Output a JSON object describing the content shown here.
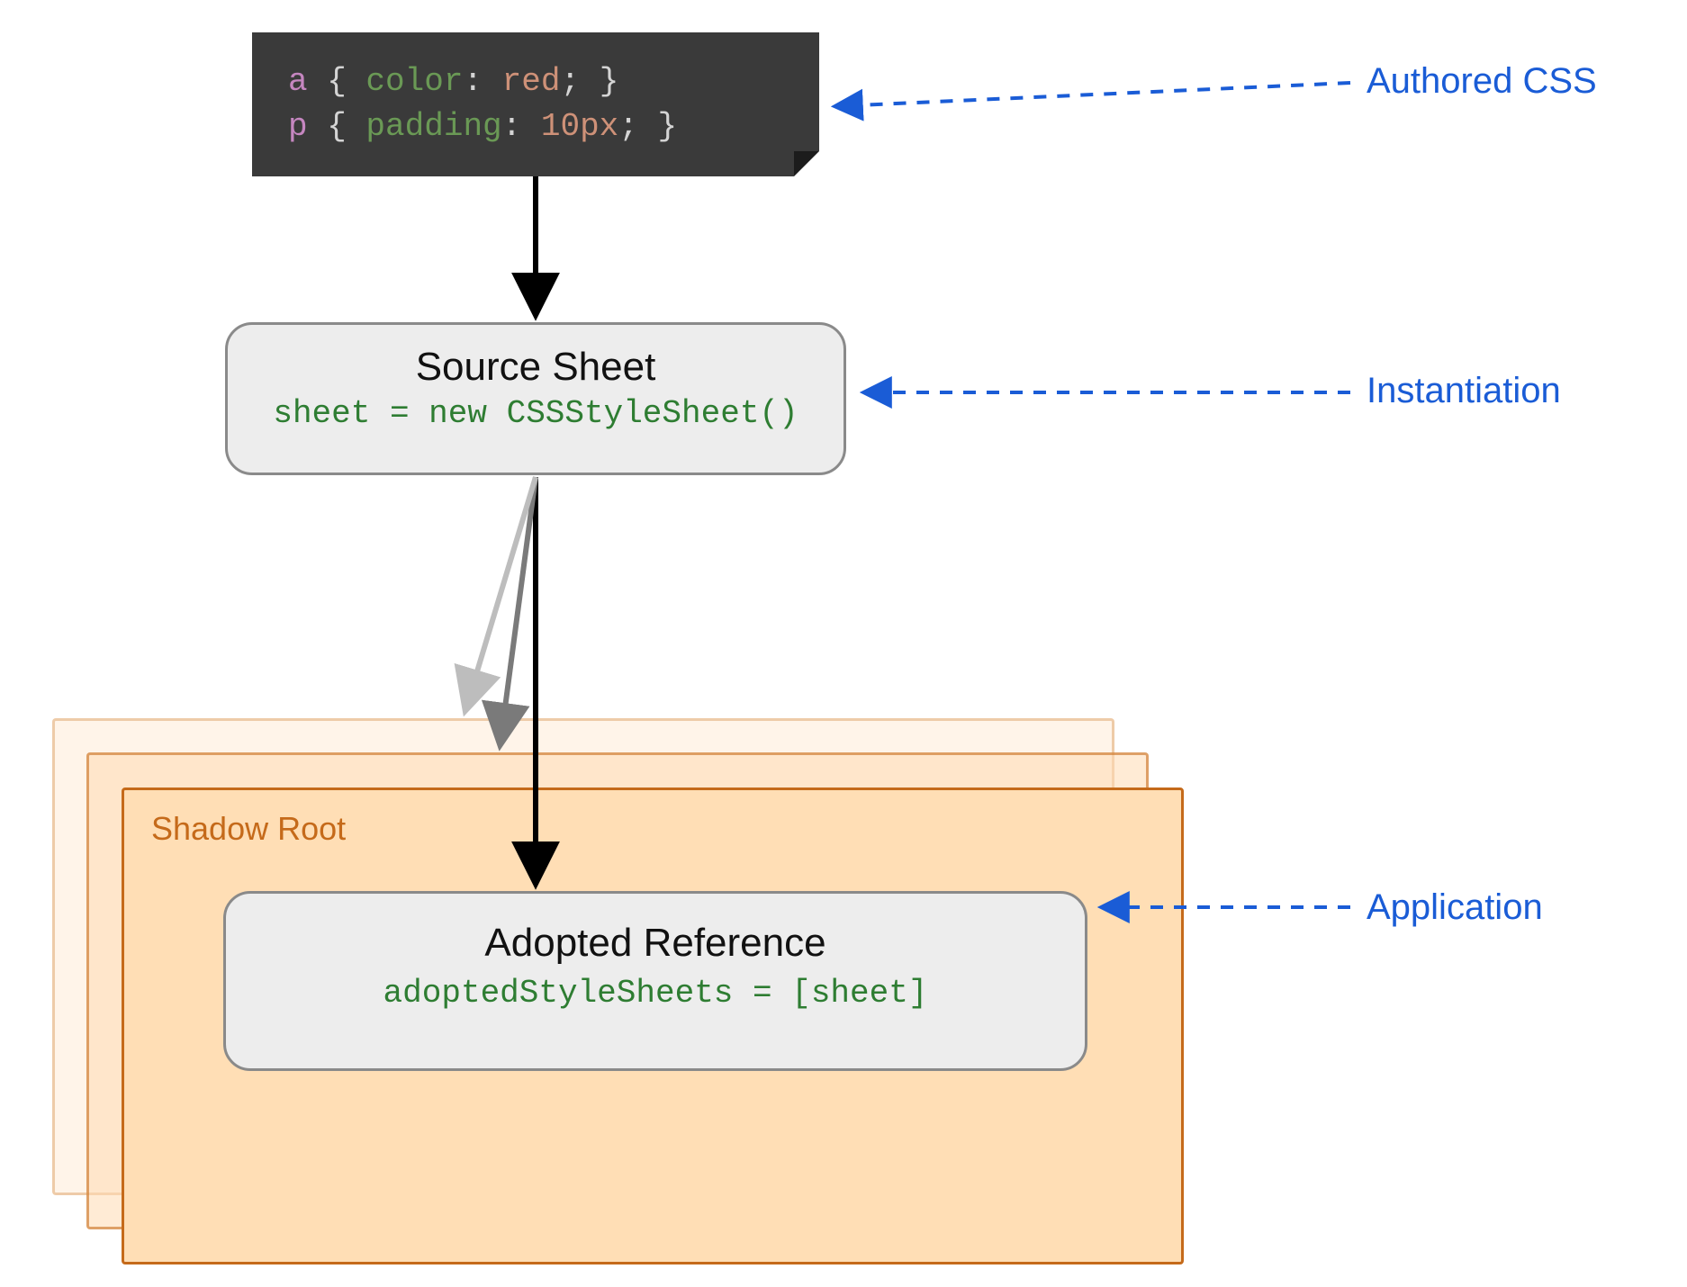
{
  "codeblock": {
    "line1": {
      "sel": "a",
      "brace1": " { ",
      "prop": "color",
      "colon": ": ",
      "val": "red",
      "end": "; }"
    },
    "line2": {
      "sel": "p",
      "brace1": " { ",
      "prop": "padding",
      "colon": ": ",
      "val": "10px",
      "end": "; }"
    }
  },
  "source_sheet": {
    "title": "Source Sheet",
    "code": "sheet = new CSSStyleSheet()"
  },
  "shadow_root": {
    "label": "Shadow Root"
  },
  "adopted_reference": {
    "title": "Adopted Reference",
    "code": "adoptedStyleSheets = [sheet]"
  },
  "annotations": {
    "authored_css": "Authored CSS",
    "instantiation": "Instantiation",
    "application": "Application"
  },
  "colors": {
    "annotation_blue": "#1a5cd6",
    "code_bg": "#3a3a3a",
    "box_bg": "#ededed",
    "shadow_panel": "#ffdeb5",
    "shadow_border": "#c56a1a",
    "code_green": "#2e7d32"
  }
}
